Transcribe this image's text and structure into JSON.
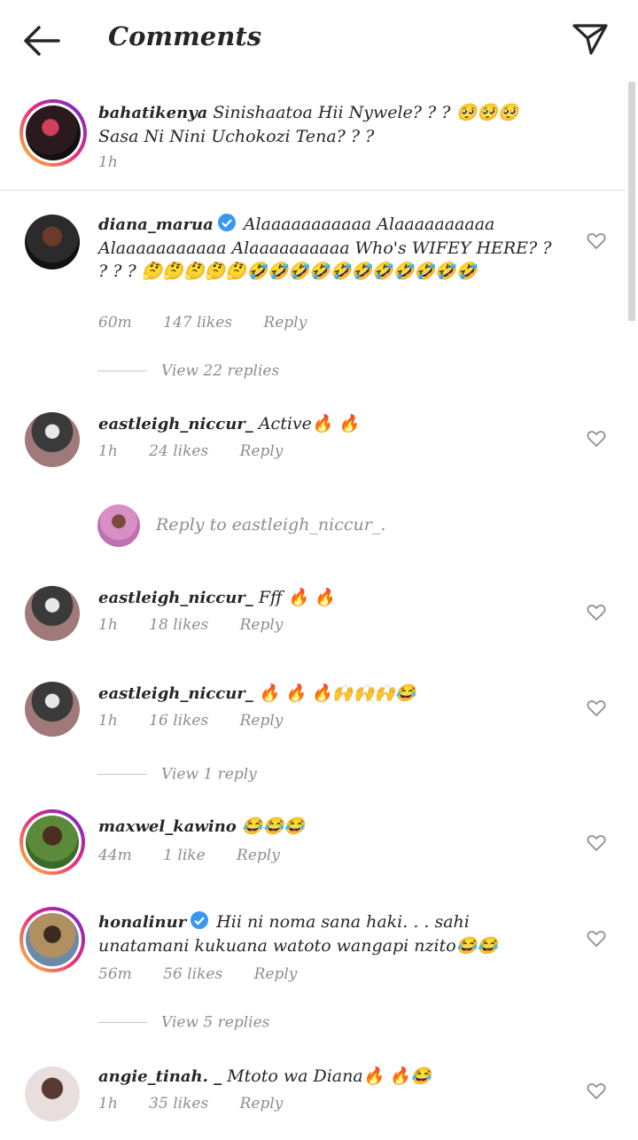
{
  "header": {
    "title": "Comments",
    "back_icon": "back-arrow-icon",
    "send_icon": "paper-plane-icon"
  },
  "caption": {
    "username": "bahatikenya",
    "text": "Sinishaatoa Hii Nywele? ? ?  🥺🥺🥺 Sasa Ni Nini Uchokozi Tena? ? ?",
    "time": "1h"
  },
  "comments": [
    {
      "username": "diana_marua",
      "verified": true,
      "text": "Alaaaaaaaaaaa Alaaaaaaaaaa Alaaaaaaaaaaa Alaaaaaaaaaa  Who's WIFEY HERE? ? ? ? ?  🤔🤔🤔🤔🤔🤣🤣🤣🤣🤣🤣🤣🤣🤣🤣🤣",
      "time": "60m",
      "likes": "147 likes",
      "reply": "Reply",
      "view_replies": "View 22 replies"
    },
    {
      "username": "eastleigh_niccur_",
      "verified": false,
      "text": "Active🔥 🔥",
      "time": "1h",
      "likes": "24 likes",
      "reply": "Reply"
    },
    {
      "username": "eastleigh_niccur_",
      "verified": false,
      "text": "Fff 🔥 🔥",
      "time": "1h",
      "likes": "18 likes",
      "reply": "Reply"
    },
    {
      "username": "eastleigh_niccur_",
      "verified": false,
      "text": "🔥 🔥 🔥🙌🙌🙌😂",
      "time": "1h",
      "likes": "16 likes",
      "reply": "Reply",
      "view_replies": "View 1 reply"
    },
    {
      "username": "maxwel_kawino",
      "verified": false,
      "text": "😂😂😂",
      "time": "44m",
      "likes": "1 like",
      "reply": "Reply"
    },
    {
      "username": "honalinur",
      "verified": true,
      "text": "Hii ni noma sana haki. . . sahi unatamani kukuana watoto wangapi nzito😂😂",
      "time": "56m",
      "likes": "56 likes",
      "reply": "Reply",
      "view_replies": "View 5 replies"
    },
    {
      "username": "angie_tinah. _",
      "verified": false,
      "text": "Mtoto wa Diana🔥 🔥😂",
      "time": "1h",
      "likes": "35 likes",
      "reply": "Reply"
    }
  ],
  "reply_box": {
    "placeholder": "Reply to eastleigh_niccur_."
  },
  "colors": {
    "text": "#262626",
    "meta": "#8e8e8e",
    "verified": "#3897f0",
    "divider": "#dbdbdb"
  }
}
